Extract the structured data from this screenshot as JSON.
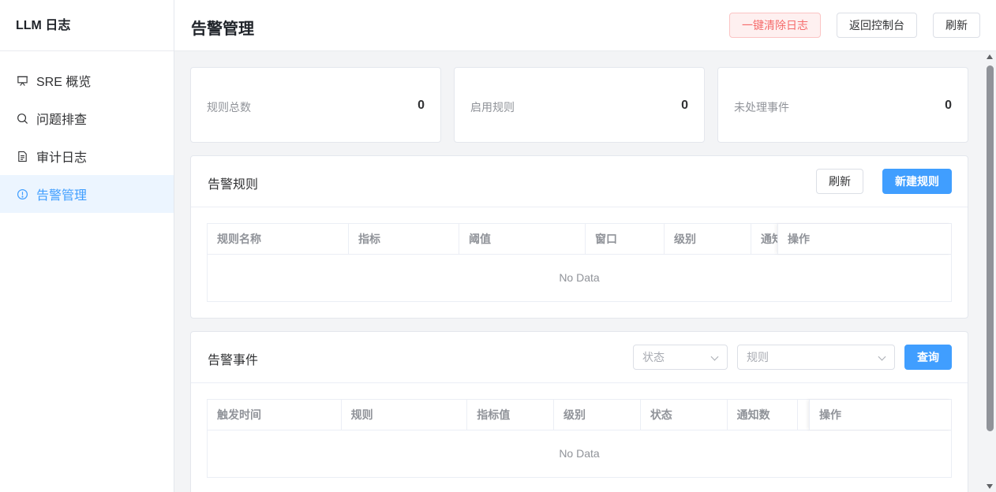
{
  "sidebar": {
    "brand": "LLM 日志",
    "items": [
      {
        "label": "SRE 概览",
        "icon": "presentation-icon"
      },
      {
        "label": "问题排查",
        "icon": "search-icon"
      },
      {
        "label": "审计日志",
        "icon": "document-icon"
      },
      {
        "label": "告警管理",
        "icon": "alert-circle-icon",
        "active": true
      }
    ]
  },
  "header": {
    "title": "告警管理",
    "clear_logs_label": "一键清除日志",
    "back_label": "返回控制台",
    "refresh_label": "刷新"
  },
  "stats": [
    {
      "label": "规则总数",
      "value": "0"
    },
    {
      "label": "启用规则",
      "value": "0"
    },
    {
      "label": "未处理事件",
      "value": "0"
    }
  ],
  "rules_panel": {
    "title": "告警规则",
    "refresh_label": "刷新",
    "new_label": "新建规则",
    "columns": [
      "规则名称",
      "指标",
      "阈值",
      "窗口",
      "级别",
      "通知",
      "操作"
    ],
    "empty_text": "No Data"
  },
  "events_panel": {
    "title": "告警事件",
    "status_placeholder": "状态",
    "rule_placeholder": "规则",
    "query_label": "查询",
    "columns": [
      "触发时间",
      "规则",
      "指标值",
      "级别",
      "状态",
      "通知数",
      "",
      "操作"
    ],
    "empty_text": "No Data"
  },
  "colors": {
    "primary": "#409eff",
    "danger": "#f56c6c",
    "active_bg": "#ecf5ff"
  }
}
